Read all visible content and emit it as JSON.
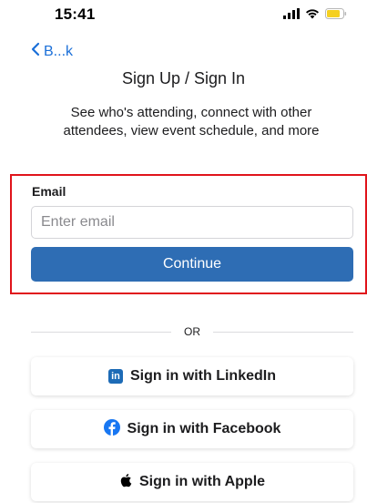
{
  "status_bar": {
    "time": "15:41"
  },
  "nav": {
    "back_label": "B...k"
  },
  "page": {
    "title": "Sign Up / Sign In",
    "subtitle": "See who's attending, connect with other attendees, view event schedule, and more"
  },
  "form": {
    "email_label": "Email",
    "email_placeholder": "Enter email",
    "email_value": "",
    "continue_label": "Continue"
  },
  "divider": {
    "text": "OR"
  },
  "social": {
    "linkedin_label": "Sign in with LinkedIn",
    "facebook_label": "Sign in with Facebook",
    "apple_label": "Sign in with Apple",
    "linkedin_icon": "linkedin-icon",
    "facebook_icon": "facebook-icon",
    "apple_icon": "apple-icon"
  },
  "colors": {
    "accent": "#1a6fd8",
    "primary_button": "#2e6db4",
    "highlight": "#e0141b",
    "linkedin": "#1d6bb6",
    "facebook": "#1877f2",
    "battery": "#f5d020"
  }
}
